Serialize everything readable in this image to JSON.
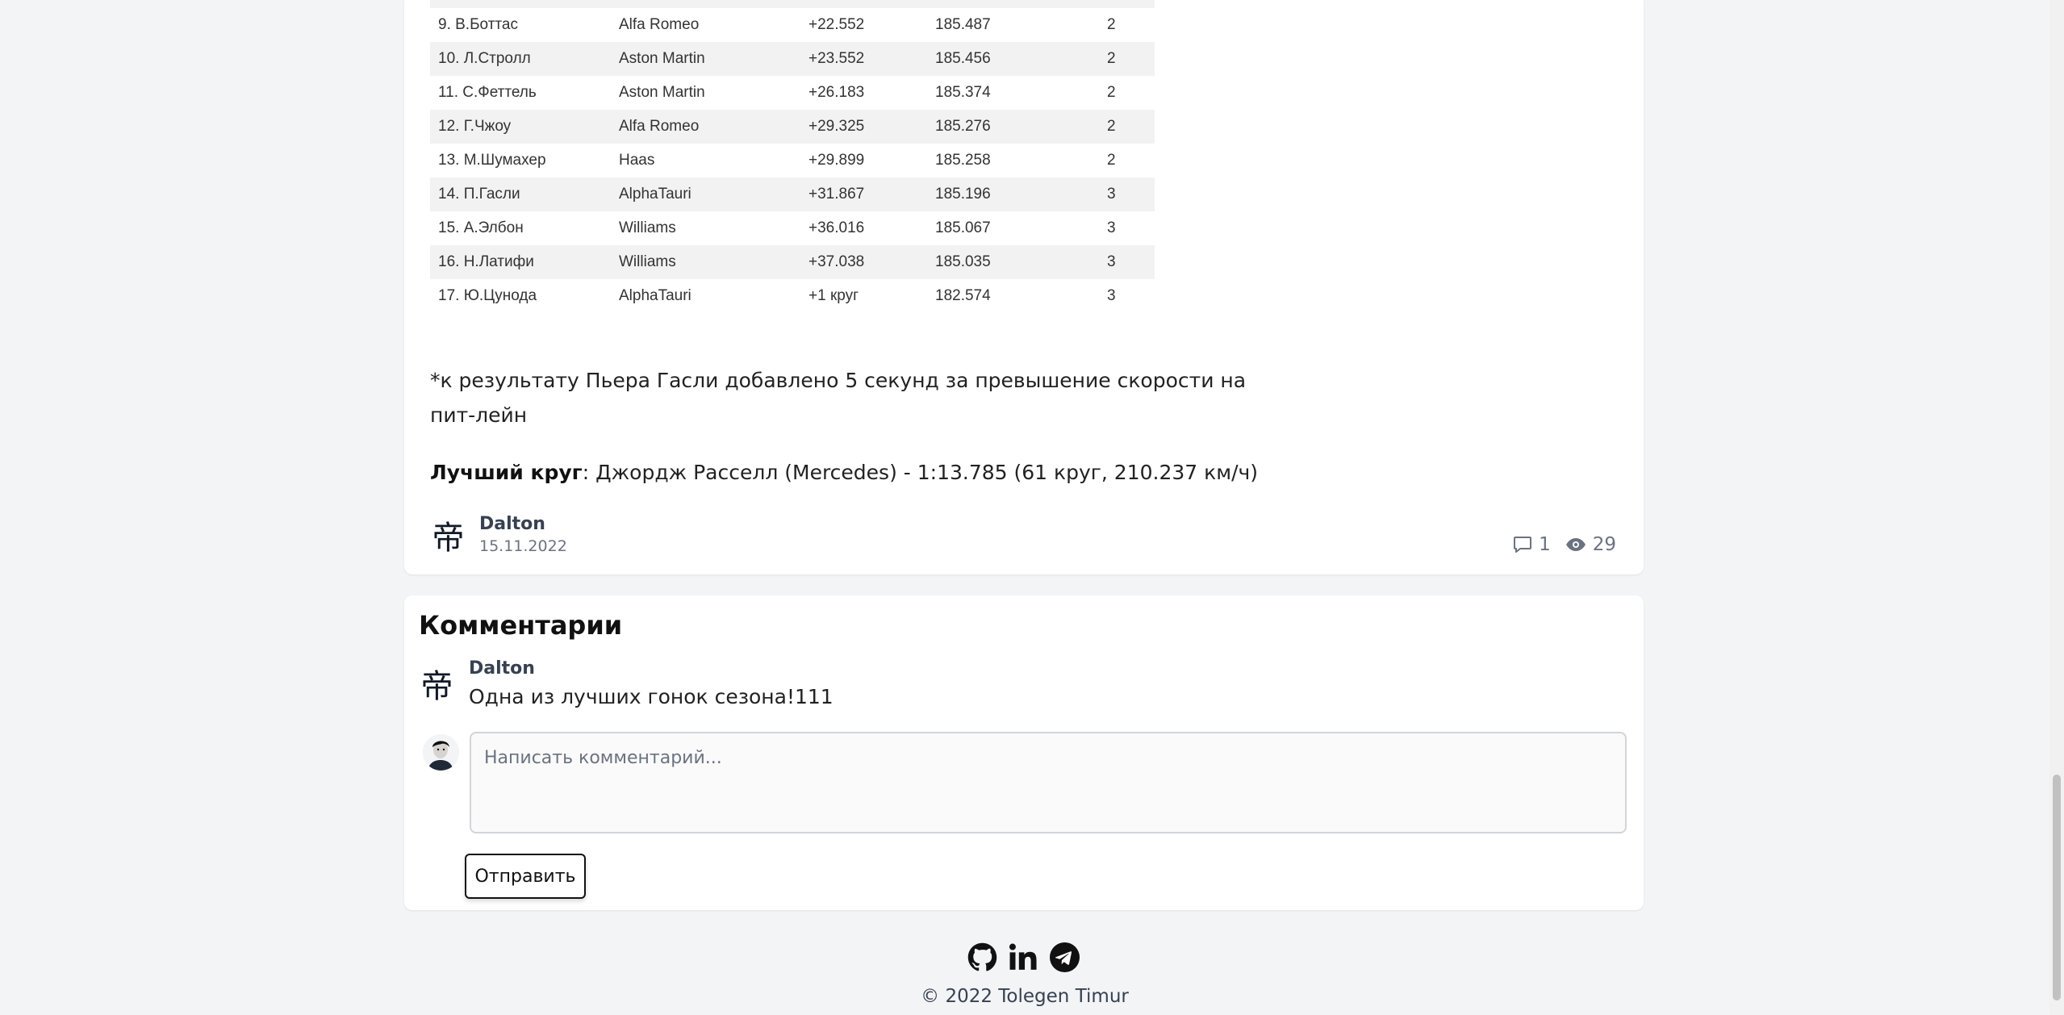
{
  "results": [
    {
      "pos": "9. В.Боттас",
      "team": "Alfa Romeo",
      "gap": "+22.552",
      "speed": "185.487",
      "stops": "2"
    },
    {
      "pos": "10. Л.Стролл",
      "team": "Aston Martin",
      "gap": "+23.552",
      "speed": "185.456",
      "stops": "2"
    },
    {
      "pos": "11. С.Феттель",
      "team": "Aston Martin",
      "gap": "+26.183",
      "speed": "185.374",
      "stops": "2"
    },
    {
      "pos": "12. Г.Чжоу",
      "team": "Alfa Romeo",
      "gap": "+29.325",
      "speed": "185.276",
      "stops": "2"
    },
    {
      "pos": "13. М.Шумахер",
      "team": "Haas",
      "gap": "+29.899",
      "speed": "185.258",
      "stops": "2"
    },
    {
      "pos": "14. П.Гасли",
      "team": "AlphaTauri",
      "gap": "+31.867",
      "speed": "185.196",
      "stops": "3"
    },
    {
      "pos": "15. А.Элбон",
      "team": "Williams",
      "gap": "+36.016",
      "speed": "185.067",
      "stops": "3"
    },
    {
      "pos": "16. Н.Латифи",
      "team": "Williams",
      "gap": "+37.038",
      "speed": "185.035",
      "stops": "3"
    },
    {
      "pos": "17. Ю.Цунода",
      "team": "AlphaTauri",
      "gap": "+1 круг",
      "speed": "182.574",
      "stops": "3"
    }
  ],
  "article": {
    "note": "*к результату Пьера Гасли добавлено 5 секунд за превышение скорости на пит-лейн",
    "best_lap_label": "Лучший круг",
    "best_lap_value": ": Джордж Расселл (Mercedes) - 1:13.785 (61 круг, 210.237 км/ч)",
    "author_name": "Dalton",
    "author_avatar_glyph": "帝",
    "date": "15.11.2022",
    "comments_count": "1",
    "views_count": "29"
  },
  "comments": {
    "title": "Комментарии",
    "items": [
      {
        "author": "Dalton",
        "avatar_glyph": "帝",
        "text": "Одна из лучших гонок сезона!111"
      }
    ],
    "input_placeholder": "Написать комментарий...",
    "submit_label": "Отправить"
  },
  "footer": {
    "icons": [
      "github-icon",
      "linkedin-icon",
      "telegram-icon"
    ],
    "copyright": "© 2022 Tolegen Timur"
  }
}
